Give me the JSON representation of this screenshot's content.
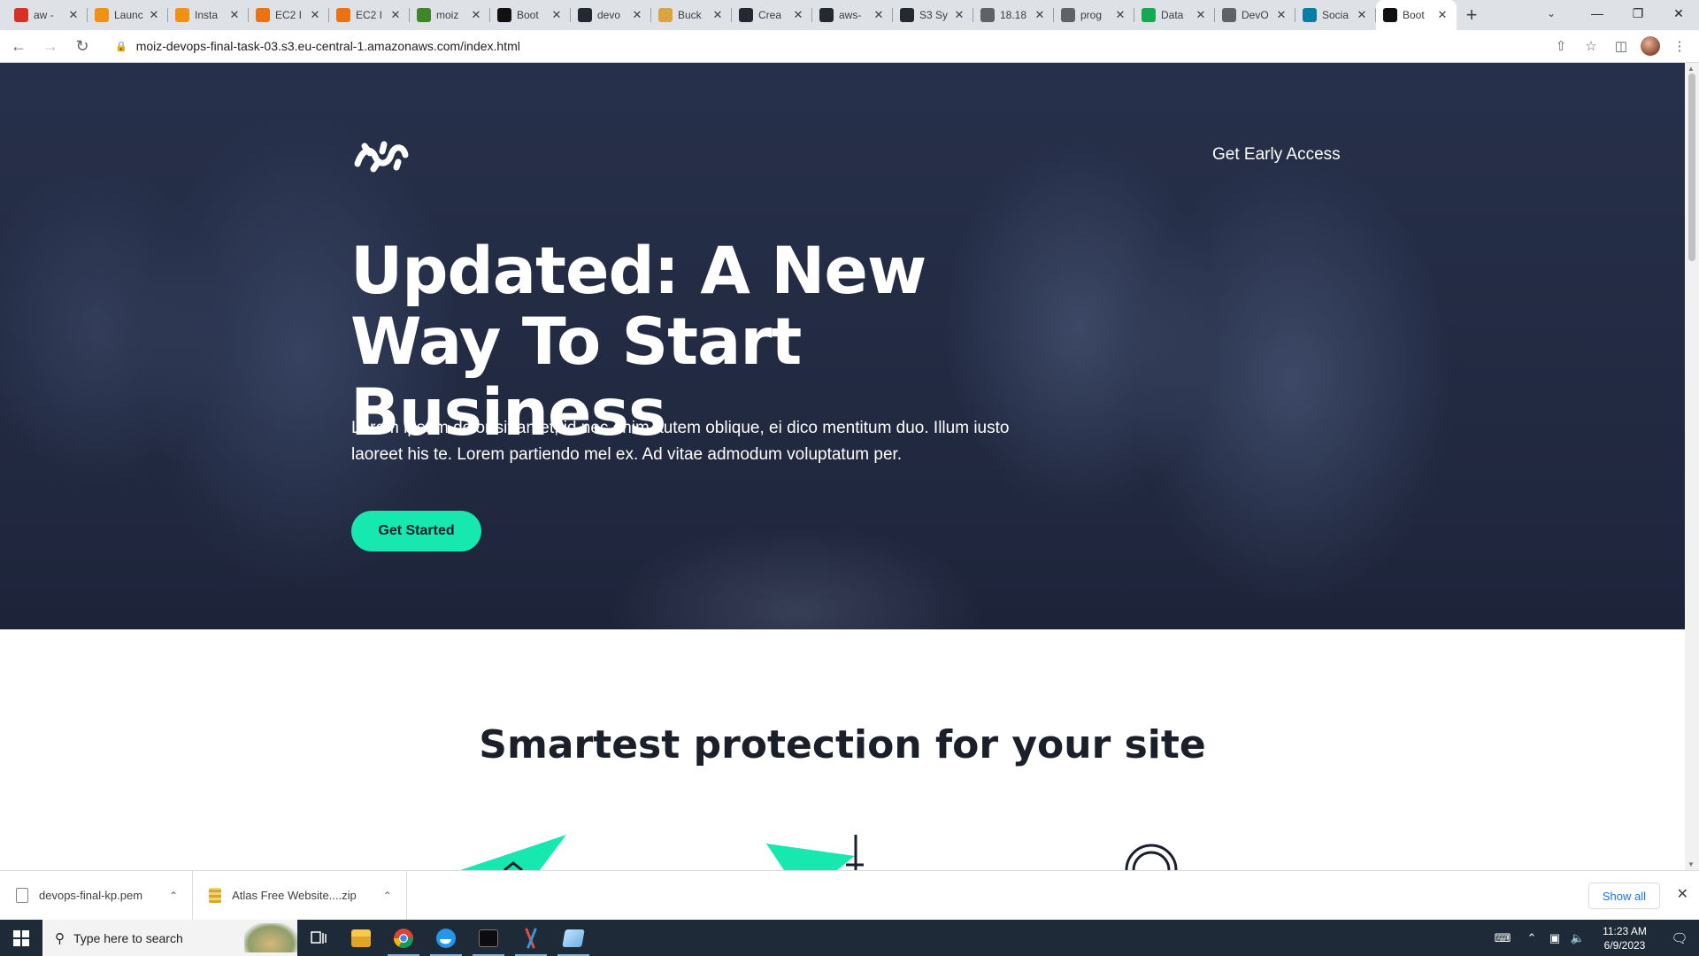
{
  "browser": {
    "tabs": [
      {
        "title": "aw -",
        "favicon": "gmail-icon",
        "color": "#d93025"
      },
      {
        "title": "Launc",
        "favicon": "aws-icon",
        "color": "#f29111"
      },
      {
        "title": "Insta",
        "favicon": "aws-icon",
        "color": "#f29111"
      },
      {
        "title": "EC2 I",
        "favicon": "ec2-icon",
        "color": "#ec7211"
      },
      {
        "title": "EC2 I",
        "favicon": "ec2-icon",
        "color": "#ec7211"
      },
      {
        "title": "moiz",
        "favicon": "s3-icon",
        "color": "#3f8624"
      },
      {
        "title": "Boot",
        "favicon": "bootstrap-icon",
        "color": "#111111"
      },
      {
        "title": "devo",
        "favicon": "github-icon",
        "color": "#24292f"
      },
      {
        "title": "Buck",
        "favicon": "bucket-icon",
        "color": "#d9a441"
      },
      {
        "title": "Crea",
        "favicon": "github-icon",
        "color": "#24292f"
      },
      {
        "title": "aws-",
        "favicon": "github-icon",
        "color": "#24292f"
      },
      {
        "title": "S3 Sy",
        "favicon": "github-icon",
        "color": "#24292f"
      },
      {
        "title": "18.18",
        "favicon": "globe-icon",
        "color": "#5f6368"
      },
      {
        "title": "prog",
        "favicon": "globe-icon",
        "color": "#5f6368"
      },
      {
        "title": "Data",
        "favicon": "mongodb-icon",
        "color": "#13aa52"
      },
      {
        "title": "DevO",
        "favicon": "globe-icon",
        "color": "#5f6368"
      },
      {
        "title": "Socia",
        "favicon": "react-icon",
        "color": "#087ea4"
      },
      {
        "title": "Boot",
        "favicon": "bootstrap-icon",
        "color": "#111111",
        "active": true
      }
    ],
    "url": "moiz-devops-final-task-03.s3.eu-central-1.amazonaws.com/index.html"
  },
  "page": {
    "early_access": "Get Early Access",
    "headline": "Updated: A New Way To Start Business",
    "lead": "Lorem ipsum dolor sit amet, id nec enim autem oblique, ei dico mentitum duo. Illum iusto laoreet his te. Lorem partiendo mel ex. Ad vitae admodum voluptatum per.",
    "cta": "Get Started",
    "section_title": "Smartest protection for your site",
    "accent": "#17e8b0"
  },
  "downloads": {
    "items": [
      {
        "name": "devops-final-kp.pem"
      },
      {
        "name": "Atlas Free Website....zip"
      }
    ],
    "show_all": "Show all"
  },
  "taskbar": {
    "search_placeholder": "Type here to search",
    "time": "11:23 AM",
    "date": "6/9/2023"
  }
}
